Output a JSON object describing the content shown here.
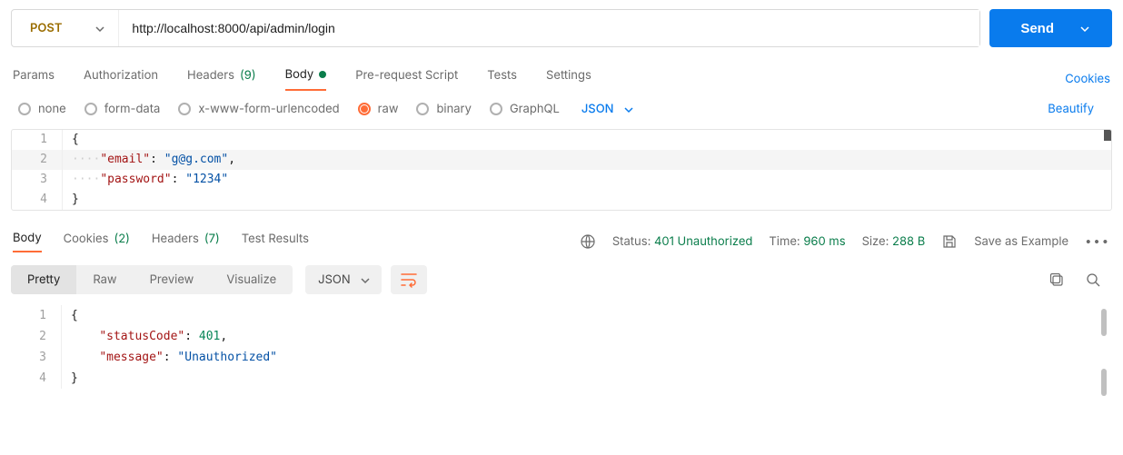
{
  "request": {
    "method": "POST",
    "url": "http://localhost:8000/api/admin/login",
    "send_label": "Send"
  },
  "tabs": {
    "params": "Params",
    "authorization": "Authorization",
    "headers_label": "Headers",
    "headers_count": "(9)",
    "body": "Body",
    "prereq": "Pre-request Script",
    "tests": "Tests",
    "settings": "Settings",
    "cookies": "Cookies"
  },
  "body_types": {
    "none": "none",
    "form_data": "form-data",
    "xwww": "x-www-form-urlencoded",
    "raw": "raw",
    "binary": "binary",
    "graphql": "GraphQL",
    "lang": "JSON",
    "beautify": "Beautify"
  },
  "request_body_lines": [
    {
      "n": "1",
      "tokens": [
        {
          "t": "{",
          "c": "punc"
        }
      ]
    },
    {
      "n": "2",
      "tokens": [
        {
          "t": "····",
          "c": "guide"
        },
        {
          "t": "\"email\"",
          "c": "key"
        },
        {
          "t": ": ",
          "c": "punc"
        },
        {
          "t": "\"g@g.com\"",
          "c": "str"
        },
        {
          "t": ",",
          "c": "punc"
        }
      ],
      "hl": true
    },
    {
      "n": "3",
      "tokens": [
        {
          "t": "····",
          "c": "guide"
        },
        {
          "t": "\"password\"",
          "c": "key"
        },
        {
          "t": ": ",
          "c": "punc"
        },
        {
          "t": "\"1234\"",
          "c": "str"
        }
      ]
    },
    {
      "n": "4",
      "tokens": [
        {
          "t": "}",
          "c": "punc"
        }
      ]
    }
  ],
  "response_tabs": {
    "body": "Body",
    "cookies_label": "Cookies",
    "cookies_count": "(2)",
    "headers_label": "Headers",
    "headers_count": "(7)",
    "test_results": "Test Results"
  },
  "response_meta": {
    "status_label": "Status:",
    "status_value": "401 Unauthorized",
    "time_label": "Time:",
    "time_value": "960 ms",
    "size_label": "Size:",
    "size_value": "288 B",
    "save_example": "Save as Example"
  },
  "response_view": {
    "pretty": "Pretty",
    "raw": "Raw",
    "preview": "Preview",
    "visualize": "Visualize",
    "lang": "JSON"
  },
  "response_body_lines": [
    {
      "n": "1",
      "tokens": [
        {
          "t": "{",
          "c": "punc"
        }
      ]
    },
    {
      "n": "2",
      "tokens": [
        {
          "t": "    ",
          "c": "plain"
        },
        {
          "t": "\"statusCode\"",
          "c": "key"
        },
        {
          "t": ": ",
          "c": "punc"
        },
        {
          "t": "401",
          "c": "num"
        },
        {
          "t": ",",
          "c": "punc"
        }
      ]
    },
    {
      "n": "3",
      "tokens": [
        {
          "t": "    ",
          "c": "plain"
        },
        {
          "t": "\"message\"",
          "c": "key"
        },
        {
          "t": ": ",
          "c": "punc"
        },
        {
          "t": "\"Unauthorized\"",
          "c": "str"
        }
      ]
    },
    {
      "n": "4",
      "tokens": [
        {
          "t": "}",
          "c": "punc"
        }
      ]
    }
  ]
}
